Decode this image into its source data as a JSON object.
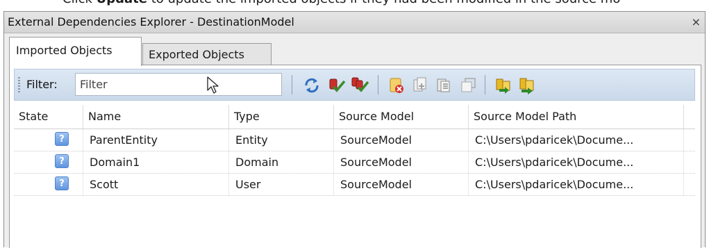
{
  "doc_line": {
    "prefix": "Click ",
    "bold": "Update",
    "suffix": " to update the imported objects if they had been modified in the source mo"
  },
  "window": {
    "title": "External Dependencies Explorer - DestinationModel",
    "close_glyph": "×"
  },
  "tabs": [
    {
      "label": "Imported Objects",
      "selected": true
    },
    {
      "label": "Exported Objects",
      "selected": false
    }
  ],
  "toolbar": {
    "filter_label": "Filter:",
    "filter_placeholder": "Filter",
    "filter_value": "",
    "icons": [
      "update-icon",
      "check-mark-icon",
      "check-all-icon",
      "remove-icon",
      "copy-icon",
      "properties-icon",
      "open-icon",
      "import-icon",
      "import-all-icon"
    ]
  },
  "columns": [
    "State",
    "Name",
    "Type",
    "Source Model",
    "Source Model Path"
  ],
  "rows": [
    {
      "state": "?",
      "name": "ParentEntity",
      "type": "Entity",
      "source_model": "SourceModel",
      "source_model_path": "C:\\Users\\pdaricek\\Docume..."
    },
    {
      "state": "?",
      "name": "Domain1",
      "type": "Domain",
      "source_model": "SourceModel",
      "source_model_path": "C:\\Users\\pdaricek\\Docume..."
    },
    {
      "state": "?",
      "name": "Scott",
      "type": "User",
      "source_model": "SourceModel",
      "source_model_path": "C:\\Users\\pdaricek\\Docume..."
    }
  ],
  "colors": {
    "toolbar_bg": "#cad9ea",
    "state_icon": "#5f95df",
    "check_red": "#c9302c",
    "import_yellow": "#e8b923"
  }
}
